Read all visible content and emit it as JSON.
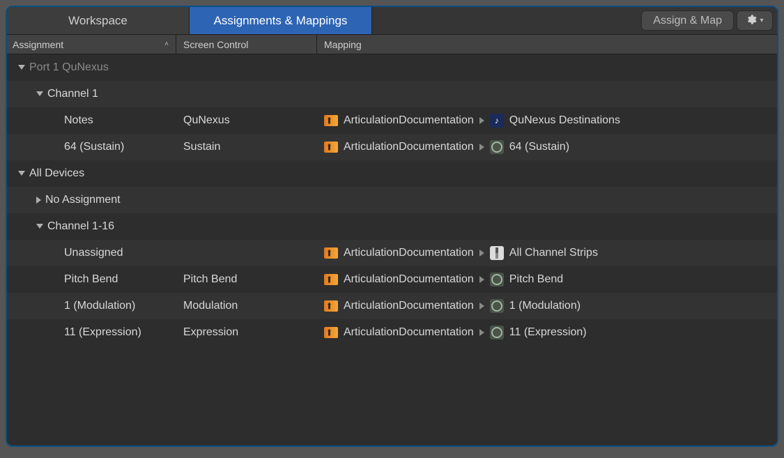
{
  "tabs": {
    "workspace": "Workspace",
    "assignments": "Assignments & Mappings"
  },
  "toolbar": {
    "assign_map": "Assign & Map"
  },
  "columns": {
    "assignment": "Assignment",
    "screen_control": "Screen Control",
    "mapping": "Mapping"
  },
  "rows": [
    {
      "indent": 16,
      "disclosure": "down",
      "label": "Port 1 QuNexus",
      "dim": true
    },
    {
      "indent": 42,
      "disclosure": "down",
      "label": "Channel 1"
    },
    {
      "indent": 82,
      "disclosure": "",
      "label": "Notes",
      "screen": "QuNexus",
      "map_folder": "ArticulationDocumentation",
      "dest_icon": "note",
      "dest": "QuNexus Destinations"
    },
    {
      "indent": 82,
      "disclosure": "",
      "label": "64 (Sustain)",
      "screen": "Sustain",
      "map_folder": "ArticulationDocumentation",
      "dest_icon": "knob",
      "dest": "64 (Sustain)"
    },
    {
      "indent": 16,
      "disclosure": "down",
      "label": "All Devices"
    },
    {
      "indent": 42,
      "disclosure": "right",
      "label": "No Assignment"
    },
    {
      "indent": 42,
      "disclosure": "down",
      "label": "Channel 1-16"
    },
    {
      "indent": 82,
      "disclosure": "",
      "label": "Unassigned",
      "screen": "",
      "map_folder": "ArticulationDocumentation",
      "dest_icon": "strip",
      "dest": "All Channel Strips"
    },
    {
      "indent": 82,
      "disclosure": "",
      "label": "Pitch Bend",
      "screen": "Pitch Bend",
      "map_folder": "ArticulationDocumentation",
      "dest_icon": "knob",
      "dest": "Pitch Bend"
    },
    {
      "indent": 82,
      "disclosure": "",
      "label": "1 (Modulation)",
      "screen": "Modulation",
      "map_folder": "ArticulationDocumentation",
      "dest_icon": "knob",
      "dest": "1 (Modulation)"
    },
    {
      "indent": 82,
      "disclosure": "",
      "label": "11 (Expression)",
      "screen": "Expression",
      "map_folder": "ArticulationDocumentation",
      "dest_icon": "knob",
      "dest": "11 (Expression)"
    }
  ]
}
